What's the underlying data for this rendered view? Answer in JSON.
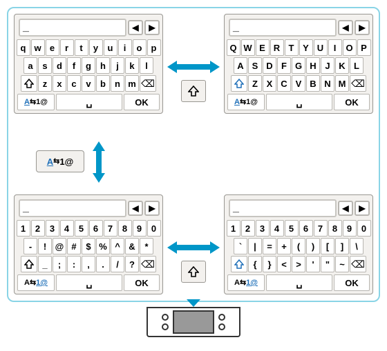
{
  "ok_label": "OK",
  "cursor": "_",
  "nav_left": "◀",
  "nav_right": "▶",
  "space_glyph": "␣",
  "bksp_glyph": "⌫",
  "keyboards": {
    "lower": {
      "row1": [
        "q",
        "w",
        "e",
        "r",
        "t",
        "y",
        "u",
        "i",
        "o",
        "p"
      ],
      "row2": [
        "a",
        "s",
        "d",
        "f",
        "g",
        "h",
        "j",
        "k",
        "l"
      ],
      "row3": [
        "z",
        "x",
        "c",
        "v",
        "b",
        "n",
        "m"
      ],
      "mode_label": {
        "letter": "A",
        "symbol": "1@"
      },
      "shift_active": false
    },
    "upper": {
      "row1": [
        "Q",
        "W",
        "E",
        "R",
        "T",
        "Y",
        "U",
        "I",
        "O",
        "P"
      ],
      "row2": [
        "A",
        "S",
        "D",
        "F",
        "G",
        "H",
        "J",
        "K",
        "L"
      ],
      "row3": [
        "Z",
        "X",
        "C",
        "V",
        "B",
        "N",
        "M"
      ],
      "mode_label": {
        "letter": "A",
        "symbol": "1@"
      },
      "shift_active": true
    },
    "sym1": {
      "row1": [
        "1",
        "2",
        "3",
        "4",
        "5",
        "6",
        "7",
        "8",
        "9",
        "0"
      ],
      "row2": [
        "-",
        "!",
        "@",
        "#",
        "$",
        "%",
        "^",
        "&",
        "*"
      ],
      "row3": [
        "_",
        ";",
        ":",
        ",",
        ".",
        "/",
        "?"
      ],
      "mode_label": {
        "letter": "A",
        "symbol": "1@"
      },
      "shift_active": false
    },
    "sym2": {
      "row1": [
        "1",
        "2",
        "3",
        "4",
        "5",
        "6",
        "7",
        "8",
        "9",
        "0"
      ],
      "row2": [
        "`",
        "|",
        "=",
        "+",
        "(",
        ")",
        "[",
        "]",
        "\\"
      ],
      "row3": [
        "{",
        "}",
        "<",
        ">",
        "'",
        "\"",
        "~"
      ],
      "mode_label": {
        "letter": "A",
        "symbol": "1@"
      },
      "shift_active": true
    }
  },
  "mode_toggle_label": {
    "letter": "A",
    "symbol": "1@"
  }
}
